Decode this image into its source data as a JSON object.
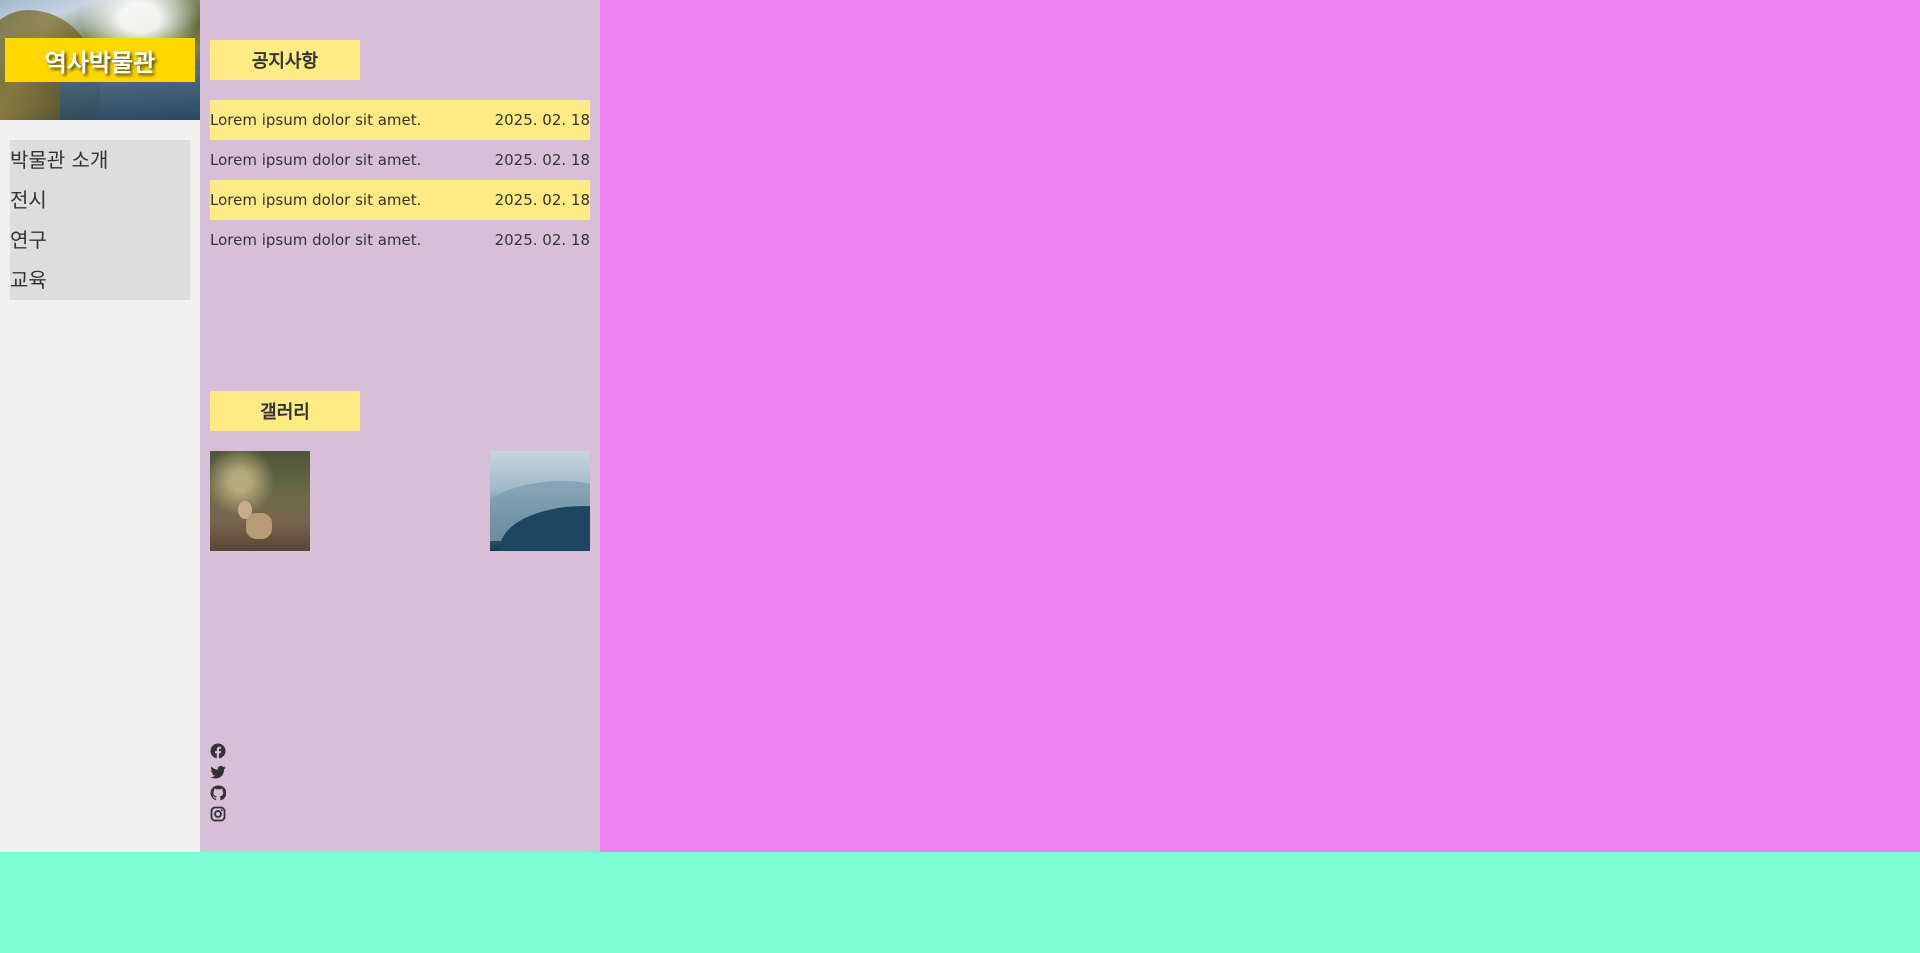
{
  "header": {
    "logo_text": "역사박물관"
  },
  "nav": {
    "items": [
      {
        "label": "박물관 소개"
      },
      {
        "label": "전시"
      },
      {
        "label": "연구"
      },
      {
        "label": "교육"
      }
    ]
  },
  "notice": {
    "title": "공지사항",
    "items": [
      {
        "text": "Lorem ipsum dolor sit amet.",
        "date": "2025. 02. 18",
        "highlighted": true
      },
      {
        "text": "Lorem ipsum dolor sit amet.",
        "date": "2025. 02. 18",
        "highlighted": false
      },
      {
        "text": "Lorem ipsum dolor sit amet.",
        "date": "2025. 02. 18",
        "highlighted": true
      },
      {
        "text": "Lorem ipsum dolor sit amet.",
        "date": "2025. 02. 18",
        "highlighted": false
      }
    ]
  },
  "gallery": {
    "title": "갤러리",
    "images": [
      {
        "subject": "deer in forest"
      },
      {
        "subject": "misty mountains"
      }
    ]
  },
  "social": {
    "icons": [
      "facebook-icon",
      "twitter-icon",
      "github-icon",
      "instagram-icon"
    ]
  },
  "colors": {
    "left_sidebar": "#f0f0f0",
    "nav_bg": "#dddddd",
    "content_column": "#d8bfd8",
    "main_area": "#ee82ee",
    "footer": "#7fffd4",
    "accent_yellow": "#ffeb84",
    "logo_yellow": "#ffd700"
  }
}
